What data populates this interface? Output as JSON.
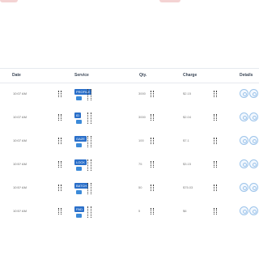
{
  "header": {
    "date": "Date",
    "service": "Service",
    "qty": "Qty.",
    "charge": "Charge",
    "details": "Details"
  },
  "rows": [
    {
      "date": "10:07 AM",
      "service": "PROFILE",
      "qty": "3000",
      "charge": "$2.15"
    },
    {
      "date": "10:07 AM",
      "service": "ID",
      "qty": "3000",
      "charge": "$2.04"
    },
    {
      "date": "10:07 AM",
      "service": "GAZE",
      "qty": "100",
      "charge": "$7.1"
    },
    {
      "date": "10:5? AM",
      "service": "LOCK",
      "qty": "75",
      "charge": "$3.15"
    },
    {
      "date": "10:5? AM",
      "service": "BATCH",
      "qty": "50",
      "charge": "$75.03"
    },
    {
      "date": "10:5? AM",
      "service": "PAD",
      "qty": "5",
      "charge": "$6"
    }
  ],
  "colors": {
    "accent": "#2a6fc9",
    "detail_icon": "#9bc3ea"
  },
  "icons": {
    "details_a": "eye-icon",
    "details_b": "edit-icon"
  }
}
